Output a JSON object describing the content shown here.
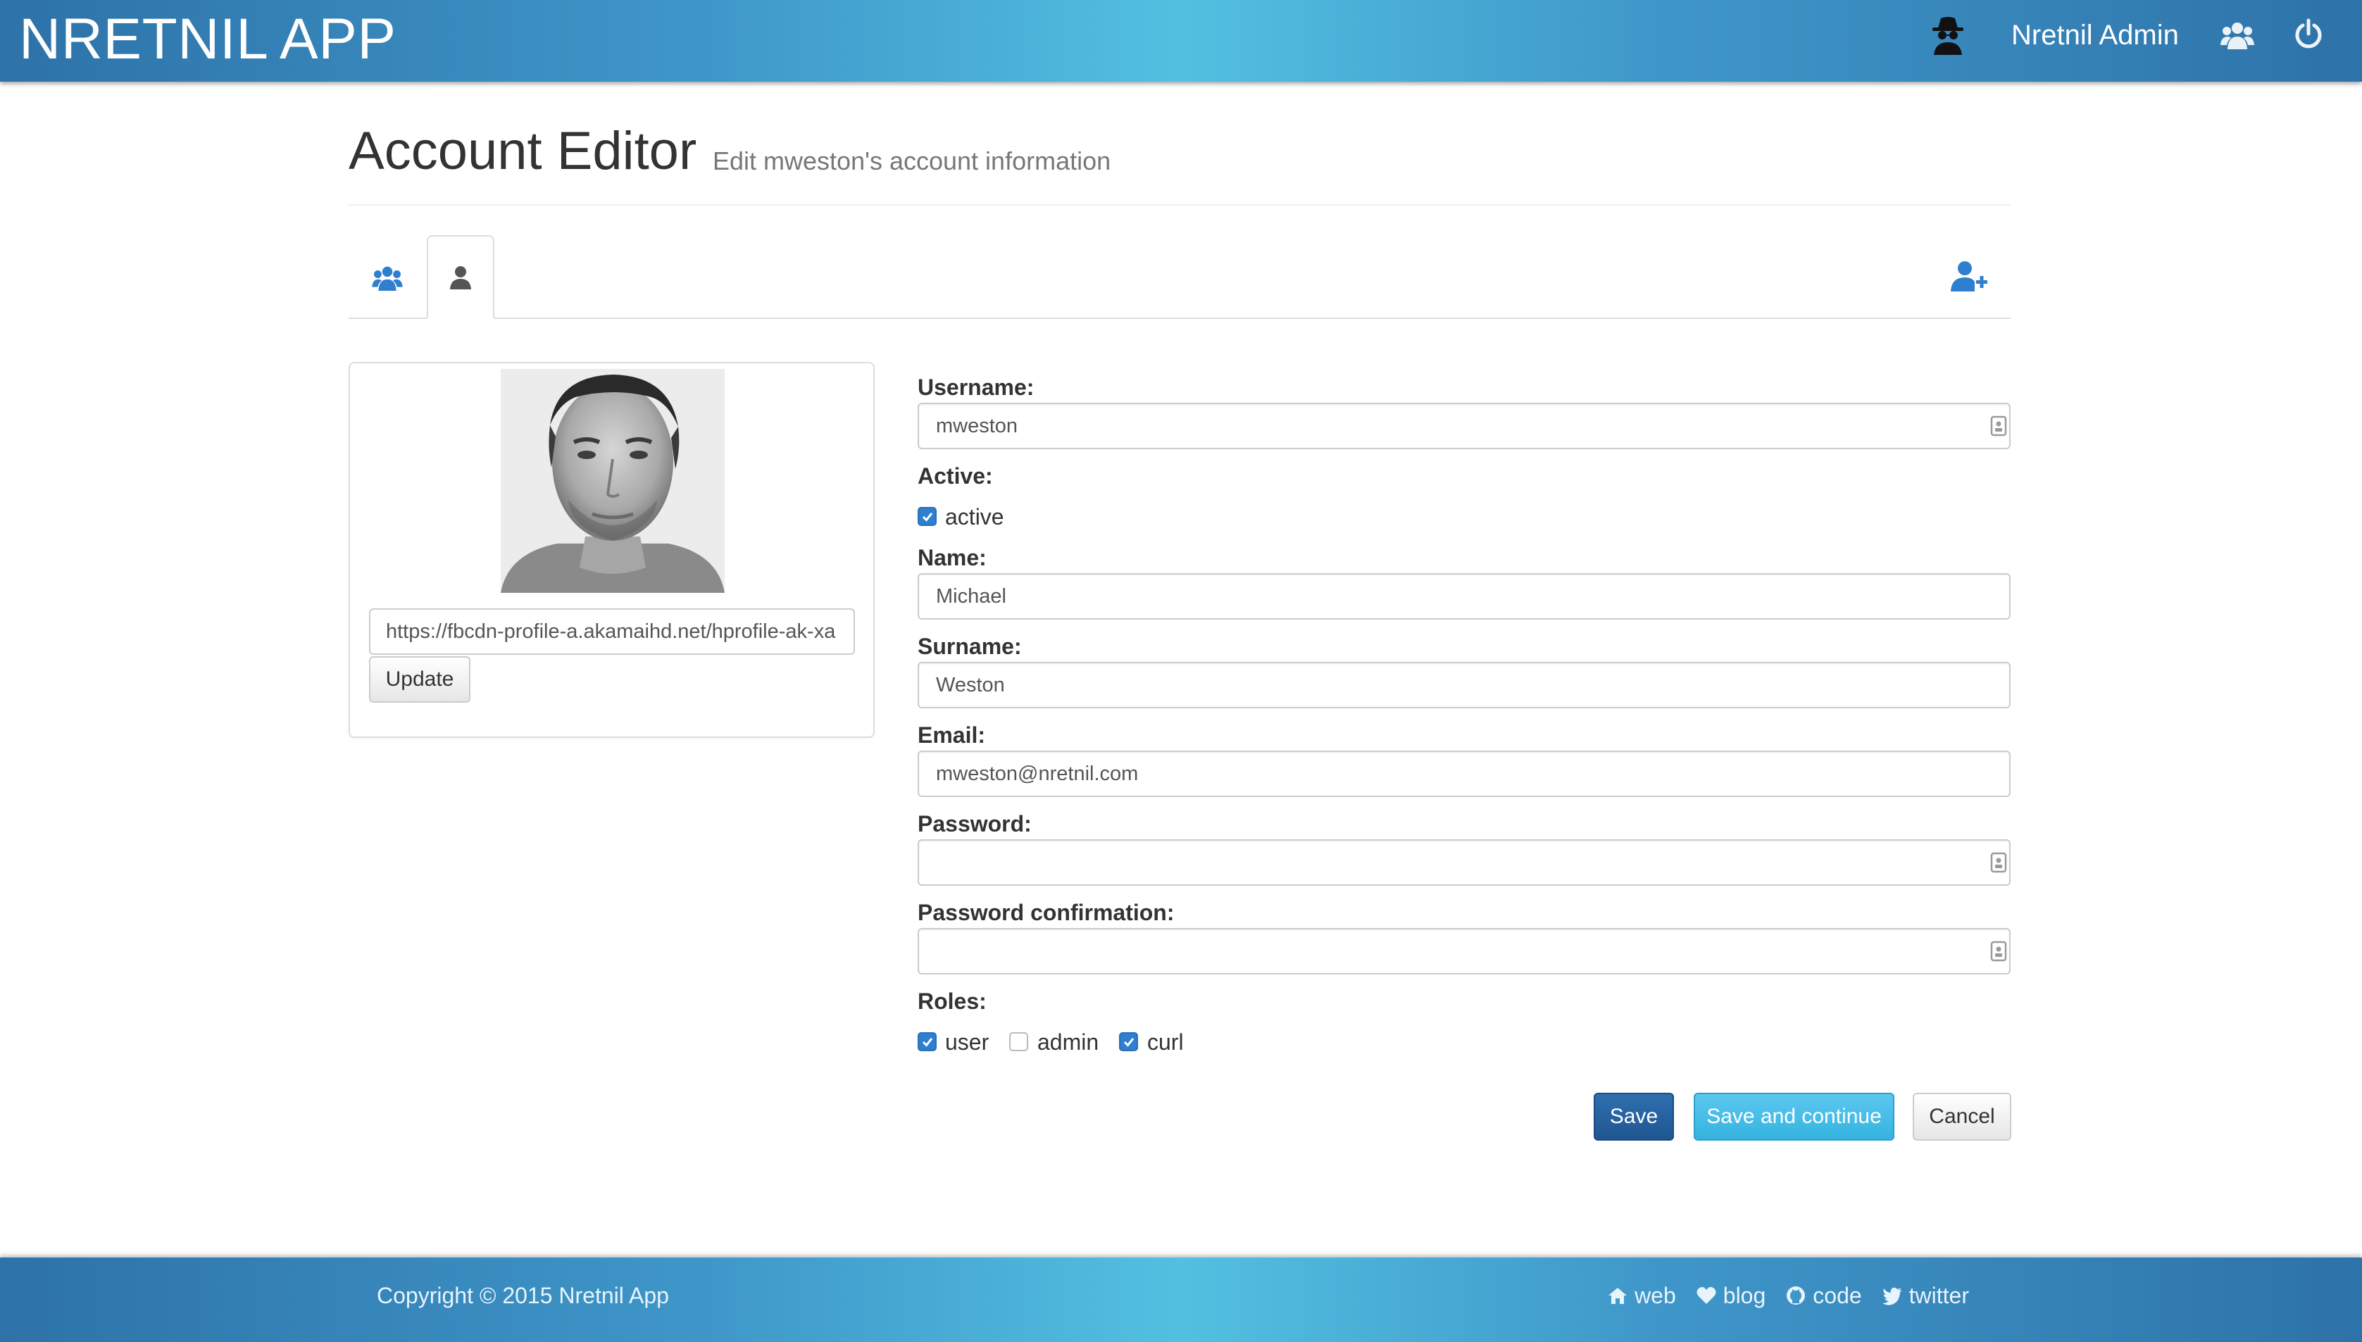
{
  "app": {
    "brand": "NRETNIL APP",
    "admin_name": "Nretnil Admin"
  },
  "header": {
    "title": "Account Editor",
    "subtitle": "Edit mweston's account information"
  },
  "avatar_panel": {
    "image_url": "https://fbcdn-profile-a.akamaihd.net/hprofile-ak-xa",
    "update_label": "Update"
  },
  "form": {
    "username_label": "Username:",
    "username_value": "mweston",
    "active_label": "Active:",
    "active_option": "active",
    "active_checked": true,
    "name_label": "Name:",
    "name_value": "Michael",
    "surname_label": "Surname:",
    "surname_value": "Weston",
    "email_label": "Email:",
    "email_value": "mweston@nretnil.com",
    "password_label": "Password:",
    "password_value": "",
    "password_confirm_label": "Password confirmation:",
    "password_confirm_value": "",
    "roles_label": "Roles:",
    "roles": [
      {
        "label": "user",
        "checked": true
      },
      {
        "label": "admin",
        "checked": false
      },
      {
        "label": "curl",
        "checked": true
      }
    ]
  },
  "actions": {
    "save_label": "Save",
    "save_continue_label": "Save and continue",
    "cancel_label": "Cancel"
  },
  "footer": {
    "copyright": "Copyright © 2015 Nretnil App",
    "links": [
      {
        "label": "web",
        "icon": "home-icon"
      },
      {
        "label": "blog",
        "icon": "heart-icon"
      },
      {
        "label": "code",
        "icon": "github-icon"
      },
      {
        "label": "twitter",
        "icon": "twitter-icon"
      }
    ]
  },
  "colors": {
    "navbar_gradient_edge": "#2d72a9",
    "navbar_gradient_center": "#52c0e1",
    "primary_button": "#1f5690",
    "info_button": "#35b3e0",
    "checkbox_checked": "#2f7fd0",
    "tab_icon_blue": "#2f7fd0"
  }
}
